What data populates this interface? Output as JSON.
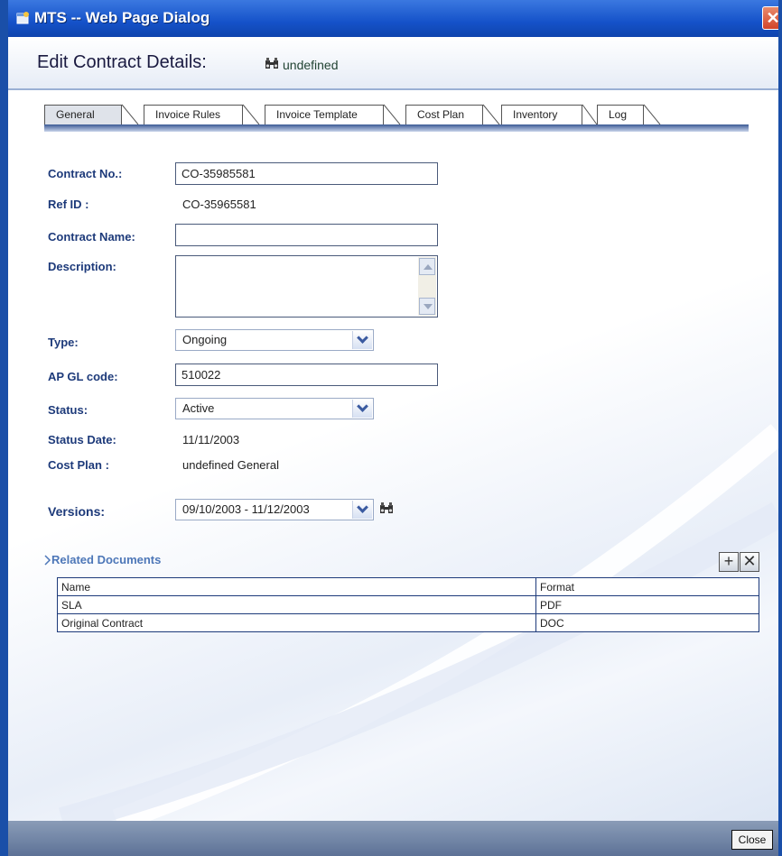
{
  "window": {
    "title": "MTS -- Web Page Dialog",
    "close_glyph": "✕"
  },
  "header": {
    "title": "Edit Contract Details:",
    "subtitle": "undefined",
    "icon": "binoculars-icon"
  },
  "tabs": [
    {
      "label": "General",
      "active": true
    },
    {
      "label": "Invoice Rules",
      "active": false
    },
    {
      "label": "Invoice Template",
      "active": false
    },
    {
      "label": "Cost Plan",
      "active": false
    },
    {
      "label": "Inventory",
      "active": false
    },
    {
      "label": "Log",
      "active": false
    }
  ],
  "form": {
    "contract_no": {
      "label": "Contract No.:",
      "value": "CO-35985581"
    },
    "ref_id": {
      "label": "Ref ID :",
      "value": "CO-35965581"
    },
    "contract_name": {
      "label": "Contract Name:",
      "value": ""
    },
    "description": {
      "label": "Description:",
      "value": ""
    },
    "type": {
      "label": "Type:",
      "value": "Ongoing"
    },
    "ap_gl_code": {
      "label": "AP GL code:",
      "value": "510022"
    },
    "status": {
      "label": "Status:",
      "value": "Active"
    },
    "status_date": {
      "label": "Status Date:",
      "value": "11/11/2003"
    },
    "cost_plan": {
      "label": "Cost Plan :",
      "value": "undefined General"
    },
    "versions": {
      "label": "Versions:",
      "value": "09/10/2003 - 11/12/2003"
    }
  },
  "related_documents": {
    "title": "Related Documents",
    "add_glyph": "+",
    "remove_glyph": "✕",
    "columns": [
      "Name",
      "Format"
    ],
    "rows": [
      [
        "SLA",
        "PDF"
      ],
      [
        "Original Contract",
        "DOC"
      ]
    ]
  },
  "footer": {
    "close_label": "Close"
  },
  "colors": {
    "titlebar": "#1552c9",
    "label": "#1d3a7a",
    "section": "#4d77b8"
  }
}
